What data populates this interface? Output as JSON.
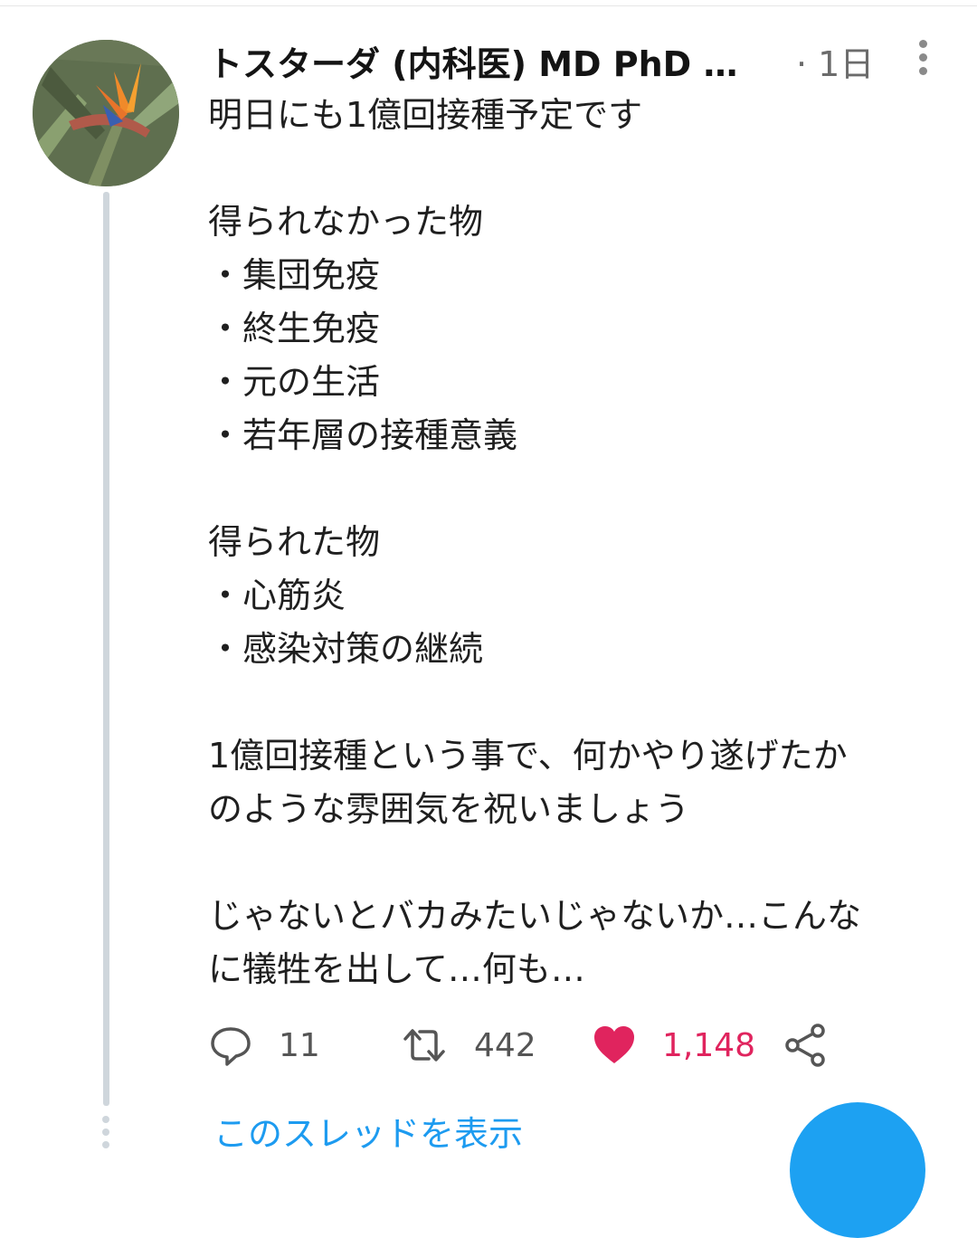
{
  "author": {
    "display_name": "トスターダ (内科医) MD PhD …"
  },
  "timestamp": "· 1日",
  "tweet_lines": [
    "明日にも1億回接種予定です",
    "",
    "得られなかった物",
    "・集団免疫",
    "・終生免疫",
    "・元の生活",
    "・若年層の接種意義",
    "",
    "得られた物",
    "・心筋炎",
    "・感染対策の継続",
    "",
    "1億回接種という事で、何かやり遂げたか",
    "のような雰囲気を祝いましょう",
    "",
    "じゃないとバカみたいじゃないか…こんな",
    "に犠牲を出して…何も…"
  ],
  "actions": {
    "reply_count": "11",
    "retweet_count": "442",
    "like_count": "1,148"
  },
  "show_thread_label": "このスレッドを表示",
  "colors": {
    "accent": "#1d9bf0",
    "like": "#e0245e",
    "thread_line": "#cfd6dc"
  }
}
